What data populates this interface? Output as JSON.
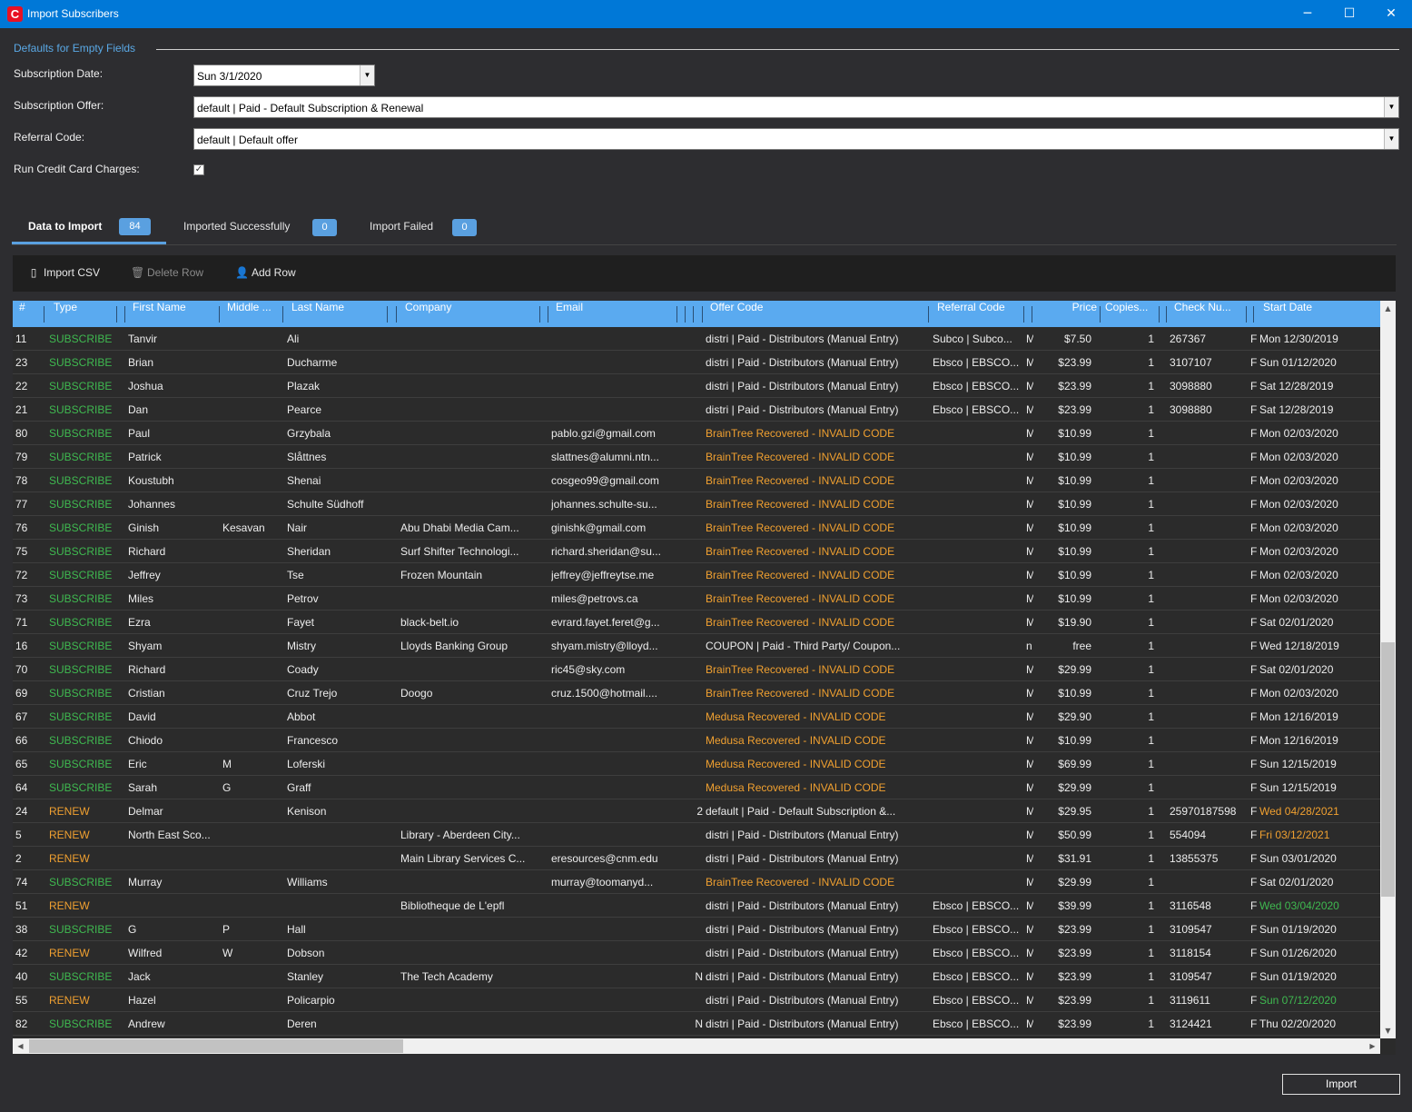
{
  "window": {
    "title": "Import Subscribers",
    "logo": "C",
    "minimize": "─",
    "maximize": "☐",
    "close": "✕"
  },
  "defaults": {
    "legend": "Defaults for Empty Fields",
    "subscription_date_label": "Subscription Date:",
    "subscription_date_value": "Sun 3/1/2020",
    "subscription_offer_label": "Subscription Offer:",
    "subscription_offer_value": "default | Paid - Default Subscription & Renewal",
    "referral_code_label": "Referral Code:",
    "referral_code_value": "default | Default offer",
    "run_cc_label": "Run Credit Card Charges:",
    "run_cc_checked": true
  },
  "tabs": [
    {
      "label": "Data to Import",
      "count": "84"
    },
    {
      "label": "Imported Successfully",
      "count": "0"
    },
    {
      "label": "Import Failed",
      "count": "0"
    }
  ],
  "toolbar": {
    "import_csv": "Import CSV",
    "delete_row": "Delete Row",
    "add_row": "Add Row"
  },
  "columns": [
    "#",
    "Type",
    "First Name",
    "Middle ...",
    "Last Name",
    "Company",
    "Email",
    "Offer Code",
    "Referral Code",
    "Price",
    "Copies...",
    "Check  Nu...",
    "Start Date"
  ],
  "rows": [
    {
      "n": "11",
      "type": "SUBSCRIBE",
      "first": "Tanvir",
      "middle": "",
      "last": "Ali",
      "company": "",
      "email": "",
      "x": "",
      "offer": "distri | Paid - Distributors (Manual Entry)",
      "offer_invalid": false,
      "ref": "Subco | Subco...",
      "m": "M",
      "price": "$7.50",
      "copies": "1",
      "check": "267367",
      "f": "F",
      "start": "Mon 12/30/2019",
      "start_color": ""
    },
    {
      "n": "23",
      "type": "SUBSCRIBE",
      "first": "Brian",
      "middle": "",
      "last": "Ducharme",
      "company": "",
      "email": "",
      "x": "",
      "offer": "distri | Paid - Distributors (Manual Entry)",
      "offer_invalid": false,
      "ref": "Ebsco | EBSCO...",
      "m": "M",
      "price": "$23.99",
      "copies": "1",
      "check": "3107107",
      "f": "F",
      "start": "Sun 01/12/2020",
      "start_color": ""
    },
    {
      "n": "22",
      "type": "SUBSCRIBE",
      "first": "Joshua",
      "middle": "",
      "last": "Plazak",
      "company": "",
      "email": "",
      "x": "",
      "offer": "distri | Paid - Distributors (Manual Entry)",
      "offer_invalid": false,
      "ref": "Ebsco | EBSCO...",
      "m": "M",
      "price": "$23.99",
      "copies": "1",
      "check": "3098880",
      "f": "F",
      "start": "Sat 12/28/2019",
      "start_color": ""
    },
    {
      "n": "21",
      "type": "SUBSCRIBE",
      "first": "Dan",
      "middle": "",
      "last": "Pearce",
      "company": "",
      "email": "",
      "x": "",
      "offer": "distri | Paid - Distributors (Manual Entry)",
      "offer_invalid": false,
      "ref": "Ebsco | EBSCO...",
      "m": "M",
      "price": "$23.99",
      "copies": "1",
      "check": "3098880",
      "f": "F",
      "start": "Sat 12/28/2019",
      "start_color": ""
    },
    {
      "n": "80",
      "type": "SUBSCRIBE",
      "first": "Paul",
      "middle": "",
      "last": "Grzybala",
      "company": "",
      "email": "pablo.gzi@gmail.com",
      "x": "",
      "offer": "BrainTree Recovered - INVALID CODE",
      "offer_invalid": true,
      "ref": "",
      "m": "M",
      "price": "$10.99",
      "copies": "1",
      "check": "",
      "f": "F",
      "start": "Mon 02/03/2020",
      "start_color": ""
    },
    {
      "n": "79",
      "type": "SUBSCRIBE",
      "first": "Patrick",
      "middle": "",
      "last": "Slåttnes",
      "company": "",
      "email": "slattnes@alumni.ntn...",
      "x": "",
      "offer": "BrainTree Recovered - INVALID CODE",
      "offer_invalid": true,
      "ref": "",
      "m": "M",
      "price": "$10.99",
      "copies": "1",
      "check": "",
      "f": "F",
      "start": "Mon 02/03/2020",
      "start_color": ""
    },
    {
      "n": "78",
      "type": "SUBSCRIBE",
      "first": "Koustubh",
      "middle": "",
      "last": "Shenai",
      "company": "",
      "email": "cosgeo99@gmail.com",
      "x": "",
      "offer": "BrainTree Recovered - INVALID CODE",
      "offer_invalid": true,
      "ref": "",
      "m": "M",
      "price": "$10.99",
      "copies": "1",
      "check": "",
      "f": "F",
      "start": "Mon 02/03/2020",
      "start_color": ""
    },
    {
      "n": "77",
      "type": "SUBSCRIBE",
      "first": "Johannes",
      "middle": "",
      "last": "Schulte Südhoff",
      "company": "",
      "email": "johannes.schulte-su...",
      "x": "",
      "offer": "BrainTree Recovered - INVALID CODE",
      "offer_invalid": true,
      "ref": "",
      "m": "M",
      "price": "$10.99",
      "copies": "1",
      "check": "",
      "f": "F",
      "start": "Mon 02/03/2020",
      "start_color": ""
    },
    {
      "n": "76",
      "type": "SUBSCRIBE",
      "first": "Ginish",
      "middle": "Kesavan",
      "last": "Nair",
      "company": "Abu Dhabi Media Cam...",
      "email": "ginishk@gmail.com",
      "x": "",
      "offer": "BrainTree Recovered - INVALID CODE",
      "offer_invalid": true,
      "ref": "",
      "m": "M",
      "price": "$10.99",
      "copies": "1",
      "check": "",
      "f": "F",
      "start": "Mon 02/03/2020",
      "start_color": ""
    },
    {
      "n": "75",
      "type": "SUBSCRIBE",
      "first": "Richard",
      "middle": "",
      "last": "Sheridan",
      "company": "Surf Shifter Technologi...",
      "email": "richard.sheridan@su...",
      "x": "",
      "offer": "BrainTree Recovered - INVALID CODE",
      "offer_invalid": true,
      "ref": "",
      "m": "M",
      "price": "$10.99",
      "copies": "1",
      "check": "",
      "f": "F",
      "start": "Mon 02/03/2020",
      "start_color": ""
    },
    {
      "n": "72",
      "type": "SUBSCRIBE",
      "first": "Jeffrey",
      "middle": "",
      "last": "Tse",
      "company": "Frozen Mountain",
      "email": "jeffrey@jeffreytse.me",
      "x": "",
      "offer": "BrainTree Recovered - INVALID CODE",
      "offer_invalid": true,
      "ref": "",
      "m": "M",
      "price": "$10.99",
      "copies": "1",
      "check": "",
      "f": "F",
      "start": "Mon 02/03/2020",
      "start_color": ""
    },
    {
      "n": "73",
      "type": "SUBSCRIBE",
      "first": "Miles",
      "middle": "",
      "last": "Petrov",
      "company": "",
      "email": "miles@petrovs.ca",
      "x": "",
      "offer": "BrainTree Recovered - INVALID CODE",
      "offer_invalid": true,
      "ref": "",
      "m": "M",
      "price": "$10.99",
      "copies": "1",
      "check": "",
      "f": "F",
      "start": "Mon 02/03/2020",
      "start_color": ""
    },
    {
      "n": "71",
      "type": "SUBSCRIBE",
      "first": "Ezra",
      "middle": "",
      "last": "Fayet",
      "company": "black-belt.io",
      "email": "evrard.fayet.feret@g...",
      "x": "",
      "offer": "BrainTree Recovered - INVALID CODE",
      "offer_invalid": true,
      "ref": "",
      "m": "M",
      "price": "$19.90",
      "copies": "1",
      "check": "",
      "f": "F",
      "start": "Sat 02/01/2020",
      "start_color": ""
    },
    {
      "n": "16",
      "type": "SUBSCRIBE",
      "first": "Shyam",
      "middle": "",
      "last": "Mistry",
      "company": "Lloyds Banking Group",
      "email": "shyam.mistry@lloyd...",
      "x": "",
      "offer": "COUPON | Paid - Third Party/ Coupon...",
      "offer_invalid": false,
      "ref": "",
      "m": "n",
      "price": "free",
      "copies": "1",
      "check": "",
      "f": "F",
      "start": "Wed 12/18/2019",
      "start_color": ""
    },
    {
      "n": "70",
      "type": "SUBSCRIBE",
      "first": "Richard",
      "middle": "",
      "last": "Coady",
      "company": "",
      "email": "ric45@sky.com",
      "x": "",
      "offer": "BrainTree Recovered - INVALID CODE",
      "offer_invalid": true,
      "ref": "",
      "m": "M",
      "price": "$29.99",
      "copies": "1",
      "check": "",
      "f": "F",
      "start": "Sat 02/01/2020",
      "start_color": ""
    },
    {
      "n": "69",
      "type": "SUBSCRIBE",
      "first": "Cristian",
      "middle": "",
      "last": "Cruz Trejo",
      "company": "Doogo",
      "email": "cruz.1500@hotmail....",
      "x": "",
      "offer": "BrainTree Recovered - INVALID CODE",
      "offer_invalid": true,
      "ref": "",
      "m": "M",
      "price": "$10.99",
      "copies": "1",
      "check": "",
      "f": "F",
      "start": "Mon 02/03/2020",
      "start_color": ""
    },
    {
      "n": "67",
      "type": "SUBSCRIBE",
      "first": "David",
      "middle": "",
      "last": "Abbot",
      "company": "",
      "email": "",
      "x": "",
      "offer": "Medusa Recovered - INVALID CODE",
      "offer_invalid": true,
      "ref": "",
      "m": "M",
      "price": "$29.90",
      "copies": "1",
      "check": "",
      "f": "F",
      "start": "Mon 12/16/2019",
      "start_color": ""
    },
    {
      "n": "66",
      "type": "SUBSCRIBE",
      "first": "Chiodo",
      "middle": "",
      "last": "Francesco",
      "company": "",
      "email": "",
      "x": "",
      "offer": "Medusa Recovered - INVALID CODE",
      "offer_invalid": true,
      "ref": "",
      "m": "M",
      "price": "$10.99",
      "copies": "1",
      "check": "",
      "f": "F",
      "start": "Mon 12/16/2019",
      "start_color": ""
    },
    {
      "n": "65",
      "type": "SUBSCRIBE",
      "first": "Eric",
      "middle": "M",
      "last": "Loferski",
      "company": "",
      "email": "",
      "x": "",
      "offer": "Medusa Recovered - INVALID CODE",
      "offer_invalid": true,
      "ref": "",
      "m": "M",
      "price": "$69.99",
      "copies": "1",
      "check": "",
      "f": "F",
      "start": "Sun 12/15/2019",
      "start_color": ""
    },
    {
      "n": "64",
      "type": "SUBSCRIBE",
      "first": "Sarah",
      "middle": "G",
      "last": "Graff",
      "company": "",
      "email": "",
      "x": "",
      "offer": "Medusa Recovered - INVALID CODE",
      "offer_invalid": true,
      "ref": "",
      "m": "M",
      "price": "$29.99",
      "copies": "1",
      "check": "",
      "f": "F",
      "start": "Sun 12/15/2019",
      "start_color": ""
    },
    {
      "n": "24",
      "type": "RENEW",
      "first": "Delmar",
      "middle": "",
      "last": "Kenison",
      "company": "",
      "email": "",
      "x": "2",
      "offer": "default | Paid - Default Subscription &...",
      "offer_invalid": false,
      "ref": "",
      "m": "M",
      "price": "$29.95",
      "copies": "1",
      "check": "25970187598",
      "f": "F",
      "start": "Wed 04/28/2021",
      "start_color": "ren"
    },
    {
      "n": "5",
      "type": "RENEW",
      "first": "North East Sco...",
      "middle": "",
      "last": "",
      "company": "Library - Aberdeen City...",
      "email": "",
      "x": "",
      "offer": "distri | Paid - Distributors (Manual Entry)",
      "offer_invalid": false,
      "ref": "",
      "m": "M",
      "price": "$50.99",
      "copies": "1",
      "check": "554094",
      "f": "F",
      "start": "Fri 03/12/2021",
      "start_color": "ren"
    },
    {
      "n": "2",
      "type": "RENEW",
      "first": "",
      "middle": "",
      "last": "",
      "company": "Main Library Services C...",
      "email": "eresources@cnm.edu",
      "x": "",
      "offer": "distri | Paid - Distributors (Manual Entry)",
      "offer_invalid": false,
      "ref": "",
      "m": "M",
      "price": "$31.91",
      "copies": "1",
      "check": "13855375",
      "f": "F",
      "start": "Sun 03/01/2020",
      "start_color": ""
    },
    {
      "n": "74",
      "type": "SUBSCRIBE",
      "first": "Murray",
      "middle": "",
      "last": "Williams",
      "company": "",
      "email": "murray@toomanyd...",
      "x": "",
      "offer": "BrainTree Recovered - INVALID CODE",
      "offer_invalid": true,
      "ref": "",
      "m": "M",
      "price": "$29.99",
      "copies": "1",
      "check": "",
      "f": "F",
      "start": "Sat 02/01/2020",
      "start_color": ""
    },
    {
      "n": "51",
      "type": "RENEW",
      "first": "",
      "middle": "",
      "last": "",
      "company": "Bibliotheque de L'epfl",
      "email": "",
      "x": "",
      "offer": "distri | Paid - Distributors (Manual Entry)",
      "offer_invalid": false,
      "ref": "Ebsco | EBSCO...",
      "m": "M",
      "price": "$39.99",
      "copies": "1",
      "check": "3116548",
      "f": "F",
      "start": "Wed 03/04/2020",
      "start_color": "grn"
    },
    {
      "n": "38",
      "type": "SUBSCRIBE",
      "first": "G",
      "middle": "P",
      "last": "Hall",
      "company": "",
      "email": "",
      "x": "",
      "offer": "distri | Paid - Distributors (Manual Entry)",
      "offer_invalid": false,
      "ref": "Ebsco | EBSCO...",
      "m": "M",
      "price": "$23.99",
      "copies": "1",
      "check": "3109547",
      "f": "F",
      "start": "Sun 01/19/2020",
      "start_color": ""
    },
    {
      "n": "42",
      "type": "RENEW",
      "first": "Wilfred",
      "middle": "W",
      "last": "Dobson",
      "company": "",
      "email": "",
      "x": "",
      "offer": "distri | Paid - Distributors (Manual Entry)",
      "offer_invalid": false,
      "ref": "Ebsco | EBSCO...",
      "m": "M",
      "price": "$23.99",
      "copies": "1",
      "check": "3118154",
      "f": "F",
      "start": "Sun 01/26/2020",
      "start_color": ""
    },
    {
      "n": "40",
      "type": "SUBSCRIBE",
      "first": "Jack",
      "middle": "",
      "last": "Stanley",
      "company": "The Tech Academy",
      "email": "",
      "x": "N",
      "offer": "distri | Paid - Distributors (Manual Entry)",
      "offer_invalid": false,
      "ref": "Ebsco | EBSCO...",
      "m": "M",
      "price": "$23.99",
      "copies": "1",
      "check": "3109547",
      "f": "F",
      "start": "Sun 01/19/2020",
      "start_color": ""
    },
    {
      "n": "55",
      "type": "RENEW",
      "first": "Hazel",
      "middle": "",
      "last": "Policarpio",
      "company": "",
      "email": "",
      "x": "",
      "offer": "distri | Paid - Distributors (Manual Entry)",
      "offer_invalid": false,
      "ref": "Ebsco | EBSCO...",
      "m": "M",
      "price": "$23.99",
      "copies": "1",
      "check": "3119611",
      "f": "F",
      "start": "Sun 07/12/2020",
      "start_color": "grn"
    },
    {
      "n": "82",
      "type": "SUBSCRIBE",
      "first": "Andrew",
      "middle": "",
      "last": "Deren",
      "company": "",
      "email": "",
      "x": "N",
      "offer": "distri | Paid - Distributors (Manual Entry)",
      "offer_invalid": false,
      "ref": "Ebsco | EBSCO...",
      "m": "M",
      "price": "$23.99",
      "copies": "1",
      "check": "3124421",
      "f": "F",
      "start": "Thu 02/20/2020",
      "start_color": ""
    }
  ],
  "footer": {
    "import_button": "Import"
  }
}
